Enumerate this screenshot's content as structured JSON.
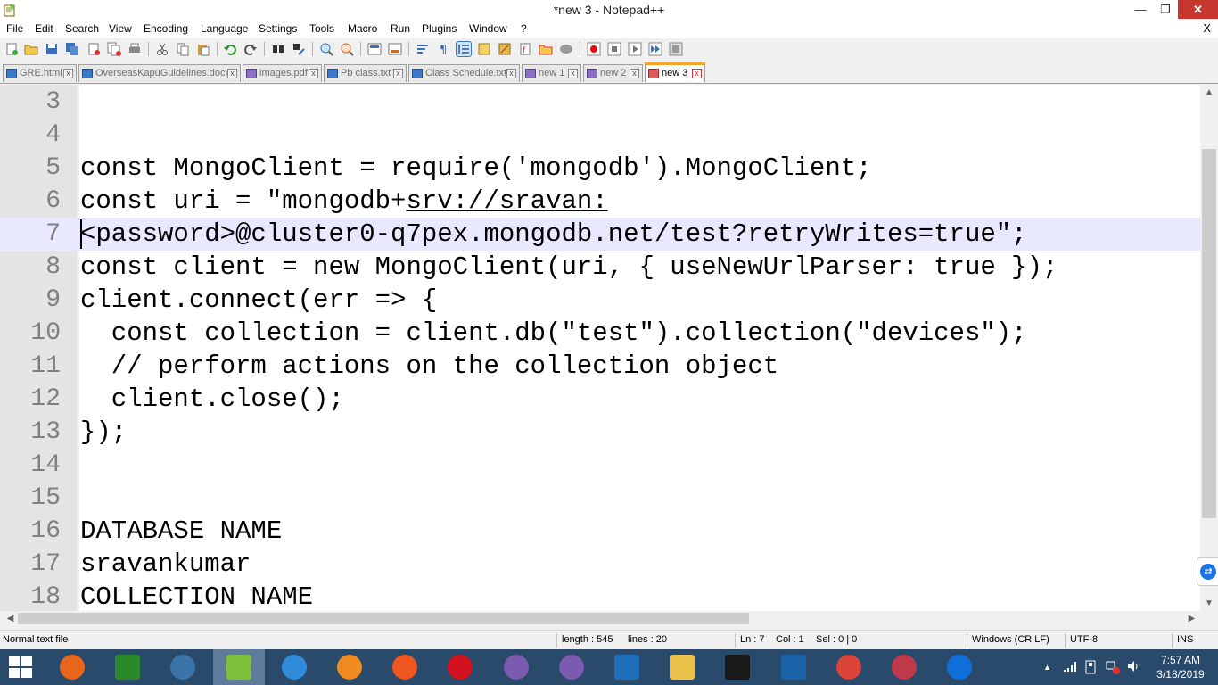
{
  "window": {
    "title": "*new 3 - Notepad++",
    "minimize_glyph": "—",
    "maximize_glyph": "❐",
    "close_glyph": "✕"
  },
  "menu": {
    "items": [
      "File",
      "Edit",
      "Search",
      "View",
      "Encoding",
      "Language",
      "Settings",
      "Tools",
      "Macro",
      "Run",
      "Plugins",
      "Window",
      "?"
    ],
    "doc_close": "X"
  },
  "tabs": [
    {
      "label": "GRE.html",
      "icon": "saved-file-icon",
      "active": false
    },
    {
      "label": "OverseasKapuGuidelines.docx",
      "icon": "saved-file-icon",
      "active": false
    },
    {
      "label": "images.pdf",
      "icon": "saved-file-icon",
      "active": false
    },
    {
      "label": "Pb class.txt",
      "icon": "saved-file-icon",
      "active": false
    },
    {
      "label": "Class Schedule.txt",
      "icon": "saved-file-icon",
      "active": false
    },
    {
      "label": "new 1",
      "icon": "saved-file-icon",
      "active": false
    },
    {
      "label": "new 2",
      "icon": "saved-file-icon",
      "active": false
    },
    {
      "label": "new 3",
      "icon": "unsaved-file-icon",
      "active": true
    }
  ],
  "editor": {
    "current_line": 7,
    "lines": [
      {
        "num": "3",
        "text": ""
      },
      {
        "num": "4",
        "text": ""
      },
      {
        "num": "5",
        "text": "const MongoClient = require('mongodb').MongoClient;"
      },
      {
        "num": "6",
        "text_before": "const uri = \"mongodb+",
        "text_link": "srv://sravan:"
      },
      {
        "num": "7",
        "text": "<password>@cluster0-q7pex.mongodb.net/test?retryWrites=true\";"
      },
      {
        "num": "8",
        "text": "const client = new MongoClient(uri, { useNewUrlParser: true });"
      },
      {
        "num": "9",
        "text": "client.connect(err => {"
      },
      {
        "num": "10",
        "text": "  const collection = client.db(\"test\").collection(\"devices\");"
      },
      {
        "num": "11",
        "text": "  // perform actions on the collection object"
      },
      {
        "num": "12",
        "text": "  client.close();"
      },
      {
        "num": "13",
        "text": "});"
      },
      {
        "num": "14",
        "text": ""
      },
      {
        "num": "15",
        "text": ""
      },
      {
        "num": "16",
        "text": "DATABASE NAME"
      },
      {
        "num": "17",
        "text": "sravankumar"
      },
      {
        "num": "18",
        "text": "COLLECTION NAME"
      }
    ]
  },
  "statusbar": {
    "file_type": "Normal text file",
    "length": "length : 545",
    "lines": "lines : 20",
    "ln": "Ln : 7",
    "col": "Col : 1",
    "sel": "Sel : 0 | 0",
    "eol": "Windows (CR LF)",
    "encoding": "UTF-8",
    "mode": "INS"
  },
  "taskbar": {
    "apps": [
      {
        "name": "firefox-icon",
        "color": "#e8661c"
      },
      {
        "name": "store-icon",
        "color": "#2a8a2a"
      },
      {
        "name": "python-icon",
        "color": "#3b74a8"
      },
      {
        "name": "notepadpp-icon",
        "color": "#7cbf3a"
      },
      {
        "name": "internet-explorer-icon",
        "color": "#2f8bd8"
      },
      {
        "name": "settings-wheel-icon",
        "color": "#f08a1e"
      },
      {
        "name": "firefox-dev-icon",
        "color": "#f0561f"
      },
      {
        "name": "opera-icon",
        "color": "#d3121f"
      },
      {
        "name": "github-cat-icon",
        "color": "#7a5bb0"
      },
      {
        "name": "github-cat-2-icon",
        "color": "#7a5bb0"
      },
      {
        "name": "split-window-icon",
        "color": "#1e6fb8"
      },
      {
        "name": "file-explorer-icon",
        "color": "#e8c04a"
      },
      {
        "name": "webstorm-icon",
        "color": "#1a1a1a"
      },
      {
        "name": "virtualbox-icon",
        "color": "#1b63a8"
      },
      {
        "name": "chrome-icon",
        "color": "#db4437"
      },
      {
        "name": "snipping-tool-icon",
        "color": "#c0394b"
      },
      {
        "name": "teamviewer-icon",
        "color": "#0e6fd8"
      }
    ],
    "active_index": 3,
    "tray_chevron": "▲",
    "clock_time": "7:57 AM",
    "clock_date": "3/18/2019"
  }
}
